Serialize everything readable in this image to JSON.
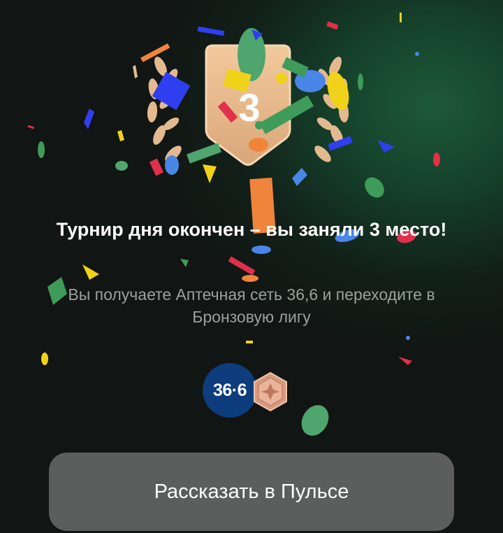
{
  "emblem": {
    "place_number": "3",
    "icon": "laurel-shield-icon"
  },
  "result": {
    "title": "Турнир дня окончен – вы заняли 3 место!",
    "subtitle": "Вы получаете Аптечная сеть 36,6 и переходите в Бронзовую лигу"
  },
  "rewards": {
    "partner_logo_text": "36·6",
    "partner_logo_icon": "pharmacy-36-6-logo-icon",
    "league_icon": "bronze-league-badge-icon"
  },
  "actions": {
    "share_label": "Рассказать в Пульсе"
  },
  "colors": {
    "background": "#121f19",
    "glow": "#1d5a38",
    "button": "#5c5e5d",
    "shield": "#e8b98c",
    "partner_logo": "#0d3d7c",
    "bronze": "#d79a7e"
  }
}
